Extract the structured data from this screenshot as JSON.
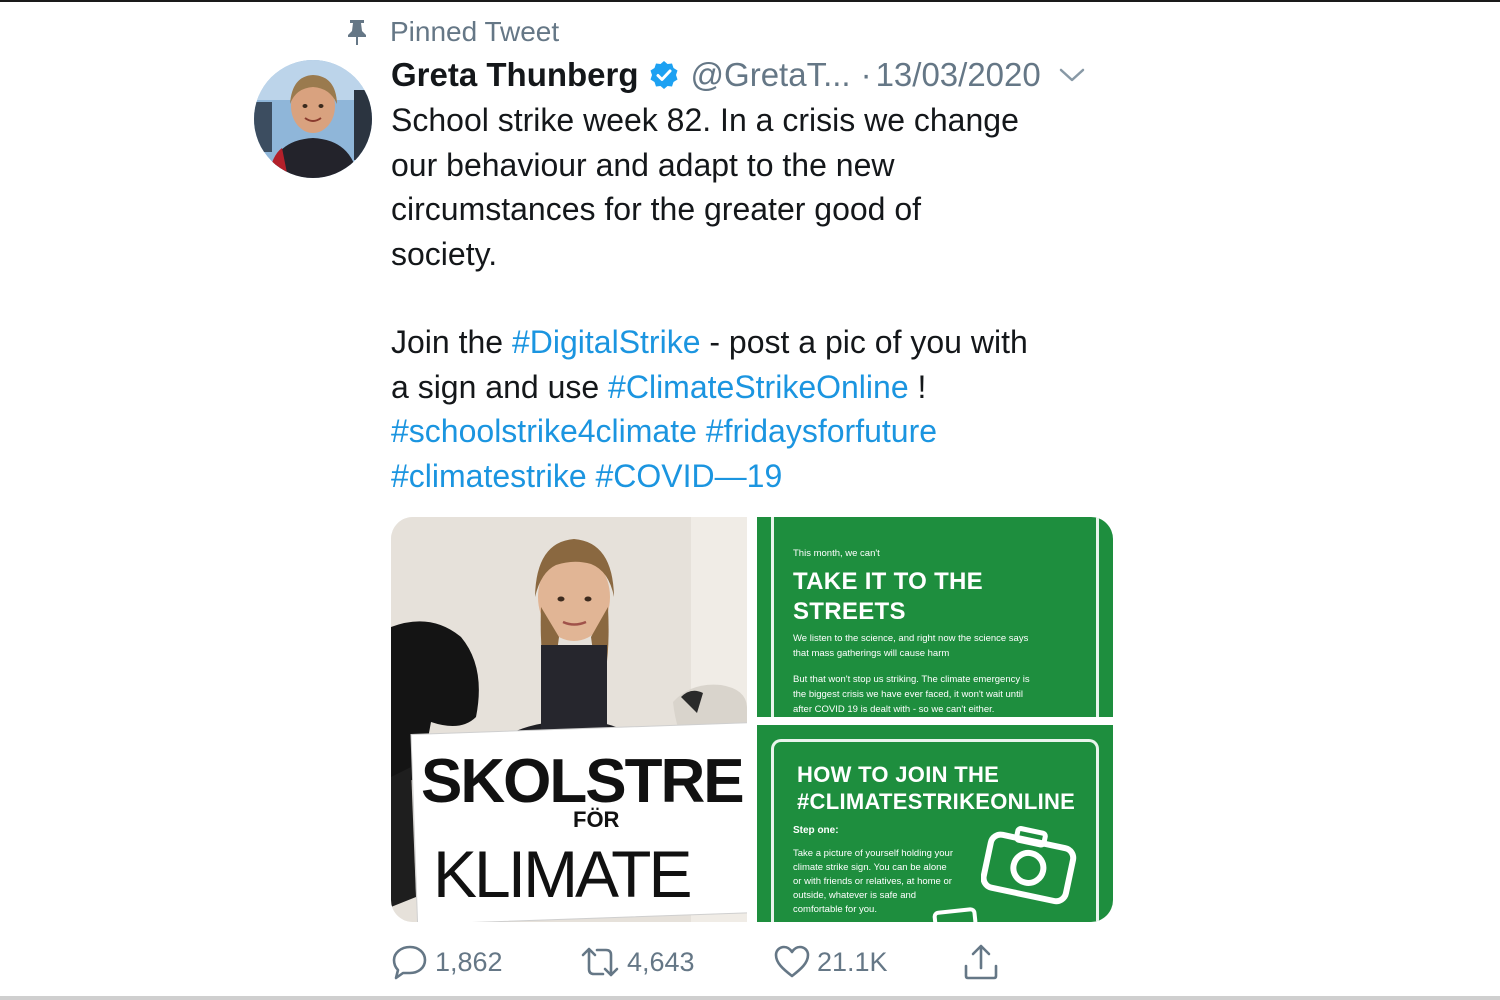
{
  "pinned": {
    "label": "Pinned Tweet",
    "icon": "pin-icon"
  },
  "author": {
    "name": "Greta Thunberg",
    "handle": "@GretaT...",
    "verified": true,
    "avatar": "avatar"
  },
  "meta": {
    "separator": "·",
    "date": "13/03/2020",
    "menu_icon": "chevron-down-icon"
  },
  "tweet": {
    "lines": [
      "School strike week 82. In a crisis we change",
      "our behaviour and adapt to the new",
      "circumstances for the greater good of",
      "society."
    ],
    "join_prefix": "Join the ",
    "hashtag_digital": "#DigitalStrike",
    "join_middle": " - post a pic of you with",
    "join_line2_prefix": "a sign and use ",
    "hashtag_online": "#ClimateStrikeOnline",
    "join_line2_suffix": " !",
    "hashtag_school": "#schoolstrike4climate",
    "hashtag_fridays": "#fridaysforfuture",
    "hashtag_climate": "#climatestrike",
    "hashtag_covid": "#COVID—19"
  },
  "media": {
    "photo_sign_line1": "SKOLSTRE",
    "photo_sign_line2": "FÖR",
    "photo_sign_line3": "KLIMATE",
    "card1": {
      "kicker": "This month, we can't",
      "title_line1": "TAKE IT TO THE",
      "title_line2": "STREETS",
      "body1_line1": "We listen to the science, and right now the science says",
      "body1_line2": "that mass gatherings will cause harm",
      "body2_line1": "But that won't stop us striking. The climate emergency is",
      "body2_line2": "the biggest crisis we have ever faced, it won't wait until",
      "body2_line3": "after COVID 19 is dealt with - so we can't either."
    },
    "card2": {
      "title_line1": "HOW TO JOIN THE",
      "title_line2": "#CLIMATESTRIKEONLINE",
      "step": "Step one:",
      "body_line1": "Take a picture of yourself holding your",
      "body_line2": "climate strike sign. You can be alone",
      "body_line3": "or with friends or relatives, at home or",
      "body_line4": "outside, whatever is safe and",
      "body_line5": "comfortable for you.",
      "icon": "camera-icon"
    }
  },
  "actions": {
    "reply_count": "1,862",
    "retweet_count": "4,643",
    "like_count": "21.1K",
    "share_icon": "share-icon"
  },
  "colors": {
    "link": "#1b95e0",
    "verified": "#1da1f2",
    "secondary_text": "#657786",
    "card_green": "#1e8e3e"
  }
}
